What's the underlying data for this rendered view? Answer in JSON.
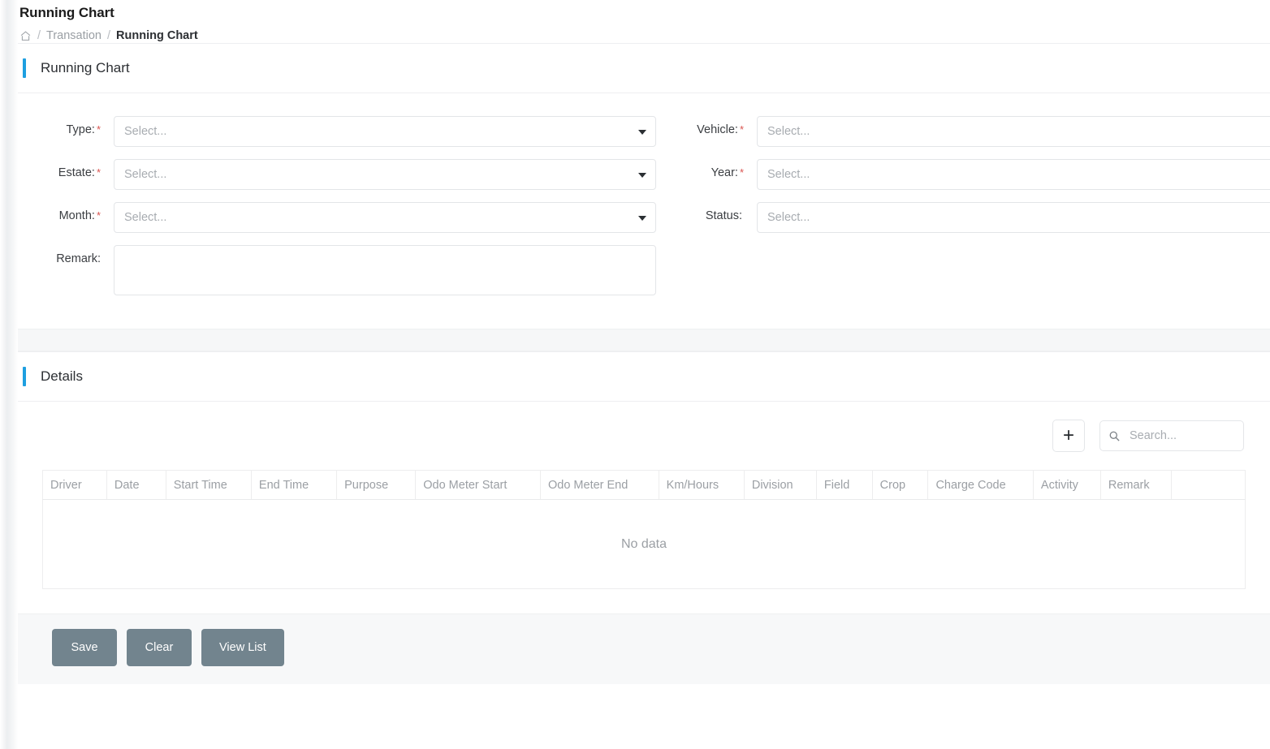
{
  "header": {
    "title": "Running Chart",
    "breadcrumb": {
      "home_icon": "home-icon",
      "sep": "/",
      "parent": "Transation",
      "current": "Running Chart"
    }
  },
  "form_section": {
    "title": "Running Chart",
    "fields": {
      "type": {
        "label": "Type:",
        "required": "*",
        "placeholder": "Select..."
      },
      "estate": {
        "label": "Estate:",
        "required": "*",
        "placeholder": "Select..."
      },
      "month": {
        "label": "Month:",
        "required": "*",
        "placeholder": "Select..."
      },
      "remark": {
        "label": "Remark:",
        "value": "",
        "placeholder": ""
      },
      "vehicle": {
        "label": "Vehicle:",
        "required": "*",
        "placeholder": "Select..."
      },
      "year": {
        "label": "Year:",
        "required": "*",
        "placeholder": "Select..."
      },
      "status": {
        "label": "Status:",
        "required": "",
        "placeholder": "Select..."
      }
    }
  },
  "details_section": {
    "title": "Details",
    "tools": {
      "add_label": "+",
      "add_icon": "plus-icon",
      "search_icon": "search-icon",
      "search_placeholder": "Search...",
      "search_value": ""
    },
    "table": {
      "columns": [
        "Driver",
        "Date",
        "Start Time",
        "End Time",
        "Purpose",
        "Odo Meter Start",
        "Odo Meter End",
        "Km/Hours",
        "Division",
        "Field",
        "Crop",
        "Charge Code",
        "Activity",
        "Remark",
        ""
      ],
      "rows": [],
      "empty_text": "No data"
    }
  },
  "footer": {
    "buttons": [
      {
        "label": "Save"
      },
      {
        "label": "Clear"
      },
      {
        "label": "View List"
      }
    ]
  },
  "colors": {
    "accent": "#1e9fe0",
    "button": "#72848e",
    "required": "#d9534f",
    "muted_text": "#9b9fa4"
  }
}
